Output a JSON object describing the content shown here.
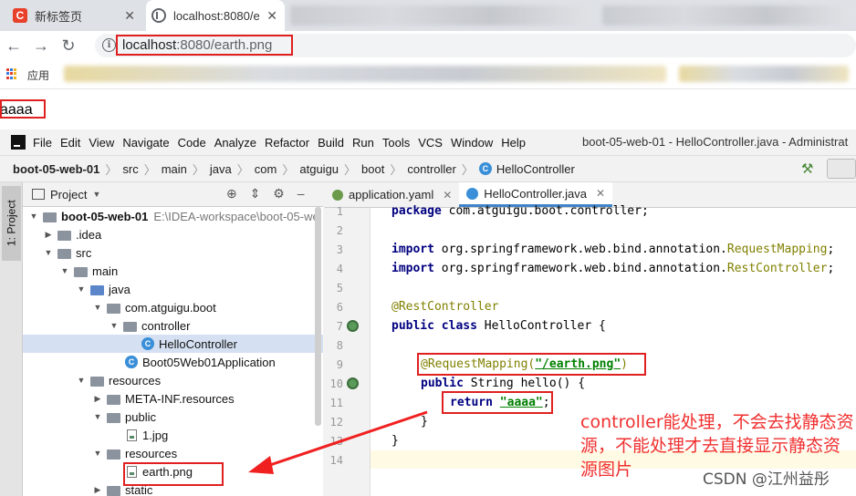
{
  "browser": {
    "tabs": [
      {
        "title": "新标签页"
      },
      {
        "title": "localhost:8080/e"
      }
    ],
    "url_host": "localhost",
    "url_rest": ":8080/earth.png",
    "bookmarks": {
      "apps_label": "应用"
    },
    "page_content": "aaaa"
  },
  "ide": {
    "menu": [
      "File",
      "Edit",
      "View",
      "Navigate",
      "Code",
      "Analyze",
      "Refactor",
      "Build",
      "Run",
      "Tools",
      "VCS",
      "Window",
      "Help"
    ],
    "title": "boot-05-web-01 - HelloController.java - Administrat",
    "breadcrumb": [
      "boot-05-web-01",
      "src",
      "main",
      "java",
      "com",
      "atguigu",
      "boot",
      "controller",
      "HelloController"
    ],
    "side_tab": "1: Project",
    "project_label": "Project",
    "tree": [
      {
        "label": "boot-05-web-01",
        "extra": "E:\\IDEA-workspace\\boot-05-we"
      },
      {
        "label": ".idea"
      },
      {
        "label": "src"
      },
      {
        "label": "main"
      },
      {
        "label": "java"
      },
      {
        "label": "com.atguigu.boot"
      },
      {
        "label": "controller"
      },
      {
        "label": "HelloController"
      },
      {
        "label": "Boot05Web01Application"
      },
      {
        "label": "resources"
      },
      {
        "label": "META-INF.resources"
      },
      {
        "label": "public"
      },
      {
        "label": "1.jpg"
      },
      {
        "label": "resources"
      },
      {
        "label": "earth.png"
      },
      {
        "label": "static"
      }
    ],
    "editor_tabs": [
      {
        "label": "application.yaml"
      },
      {
        "label": "HelloController.java"
      }
    ],
    "line_numbers": [
      "1",
      "2",
      "3",
      "4",
      "5",
      "6",
      "7",
      "8",
      "9",
      "10",
      "11",
      "12",
      "13",
      "14"
    ],
    "code": {
      "l1_kw": "package ",
      "l1_rest": "com.atguigu.boot.controller;",
      "l3_kw": "import ",
      "l3_pkg": "org.springframework.web.bind.annotation.",
      "l3_cls": "RequestMapping",
      "l4_kw": "import ",
      "l4_pkg": "org.springframework.web.bind.annotation.",
      "l4_cls": "RestController",
      "l6": "@RestController",
      "l7_kw": "public class ",
      "l7_rest": "HelloController {",
      "l9_ann": "@RequestMapping(",
      "l9_str": "\"/earth.png\"",
      "l9_end": ")",
      "l10_kw": "public ",
      "l10_rest": "String hello() {",
      "l11_kw": "return ",
      "l11_str": "\"aaaa\"",
      "l11_end": ";",
      "l12": "}",
      "l13": "}"
    }
  },
  "annotation": {
    "note": "controller能处理，不会去找静态资源，不能处理才去直接显示静态资源图片",
    "watermark": "CSDN @江州益彤"
  },
  "colors": {
    "highlight_box": "#e02020",
    "note_text": "#f03030"
  }
}
